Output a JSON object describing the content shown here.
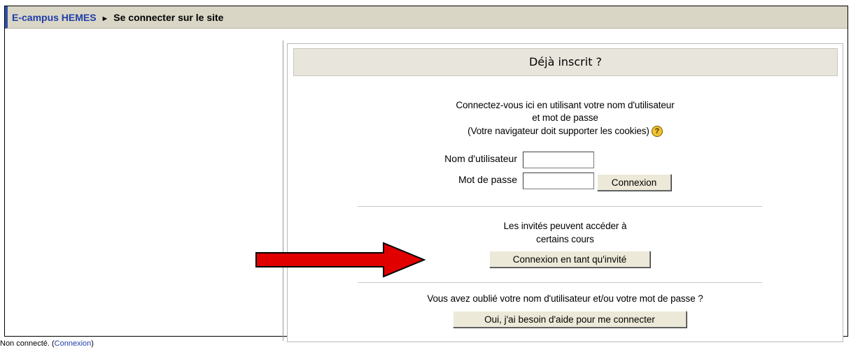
{
  "navbar": {
    "home_link": "E-campus HEMES",
    "separator": "►",
    "current": "Se connecter sur le site"
  },
  "login": {
    "title": "Déjà inscrit ?",
    "intro_line1": "Connectez-vous ici en utilisant votre nom d'utilisateur",
    "intro_line2": "et mot de passe",
    "intro_line3": "(Votre navigateur doit supporter les cookies)",
    "help_icon_glyph": "?",
    "username_label": "Nom d'utilisateur",
    "username_value": "",
    "password_label": "Mot de passe",
    "password_value": "",
    "submit_label": "Connexion"
  },
  "guest": {
    "line1": "Les invités peuvent accéder à",
    "line2": "certains cours",
    "button_label": "Connexion en tant qu'invité"
  },
  "forgot": {
    "question": "Vous avez oublié votre nom d'utilisateur et/ou votre mot de passe ?",
    "button_label": "Oui, j'ai besoin d'aide pour me connecter"
  },
  "footer": {
    "status": "Non connecté.",
    "open_paren": " (",
    "login_link": "Connexion",
    "close_paren": ")"
  },
  "colors": {
    "navbar_bg": "#d9d6c6",
    "link": "#1f3da8",
    "arrow": "#e00000"
  },
  "icons": [
    "help-icon",
    "arrow-pointer-icon"
  ]
}
